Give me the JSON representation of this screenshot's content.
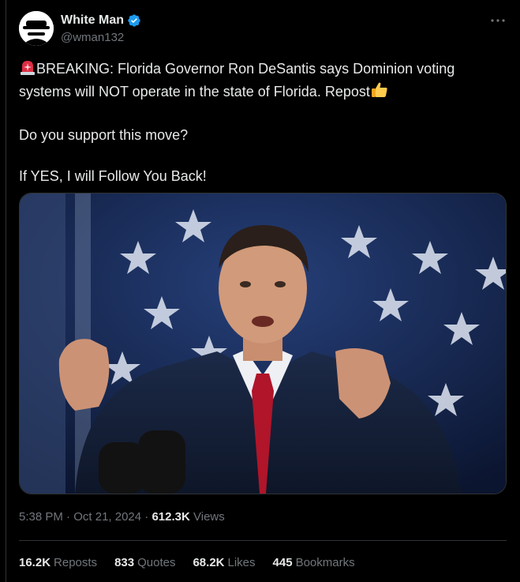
{
  "author": {
    "display_name": "White Man",
    "handle": "@wman132",
    "verified": true
  },
  "post": {
    "line1_prefix": "BREAKING: Florida Governor Ron DeSantis says Dominion voting systems will NOT operate in the state of Florida. Repost",
    "line2": "Do you support this move?",
    "line3": "If YES, I will Follow You Back!",
    "emojis": [
      "rotating-light-emoji",
      "thumbs-up-emoji"
    ]
  },
  "meta": {
    "time": "5:38 PM",
    "sep1": " · ",
    "date": "Oct 21, 2024",
    "sep2": " · ",
    "views_count": "612.3K",
    "views_label": "Views"
  },
  "stats": [
    {
      "count": "16.2K",
      "label": "Reposts"
    },
    {
      "count": "833",
      "label": "Quotes"
    },
    {
      "count": "68.2K",
      "label": "Likes"
    },
    {
      "count": "445",
      "label": "Bookmarks"
    }
  ],
  "colors": {
    "background": "#000000",
    "text": "#e7e9ea",
    "secondary": "#71767b",
    "border": "#2f3336",
    "verified": "#1d9bf0"
  }
}
